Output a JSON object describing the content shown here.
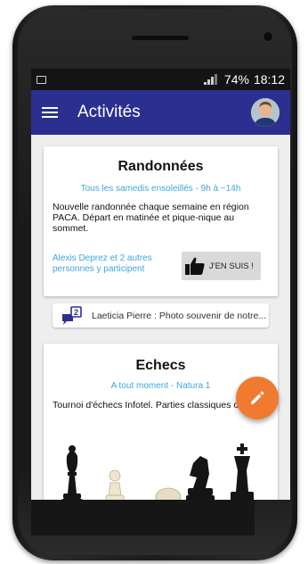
{
  "status_bar": {
    "battery": "74%",
    "time": "18:12"
  },
  "app_bar": {
    "title": "Activités",
    "menu_icon": "hamburger-menu-icon",
    "avatar_icon": "user-avatar"
  },
  "cards": [
    {
      "title": "Randonnées",
      "subtitle": "Tous les samedis ensoleillés - 9h à ~14h",
      "description": "Nouvelle randonnée chaque semaine en région PACA. Départ en matinée et pique-nique au sommet.",
      "participants": "Alexis Deprez et 2 autres personnes y participent",
      "join_label": "J'EN SUIS !",
      "join_icon": "thumbs-up-icon"
    },
    {
      "title": "Echecs",
      "subtitle": "A tout moment - Natura 1",
      "description": "Tournoi d'échecs Infotel. Parties classiques ou blitz",
      "image": "chess-pieces-illustration"
    }
  ],
  "comment": {
    "count": "2",
    "text": "Laeticia Pierre : Photo souvenir de notre...",
    "icon": "chat-bubbles-icon"
  },
  "fab": {
    "icon": "pencil-icon",
    "color": "#f07a30"
  },
  "colors": {
    "app_bar": "#2b2f8f",
    "accent_text": "#3ea6de",
    "fab": "#f07a30"
  }
}
